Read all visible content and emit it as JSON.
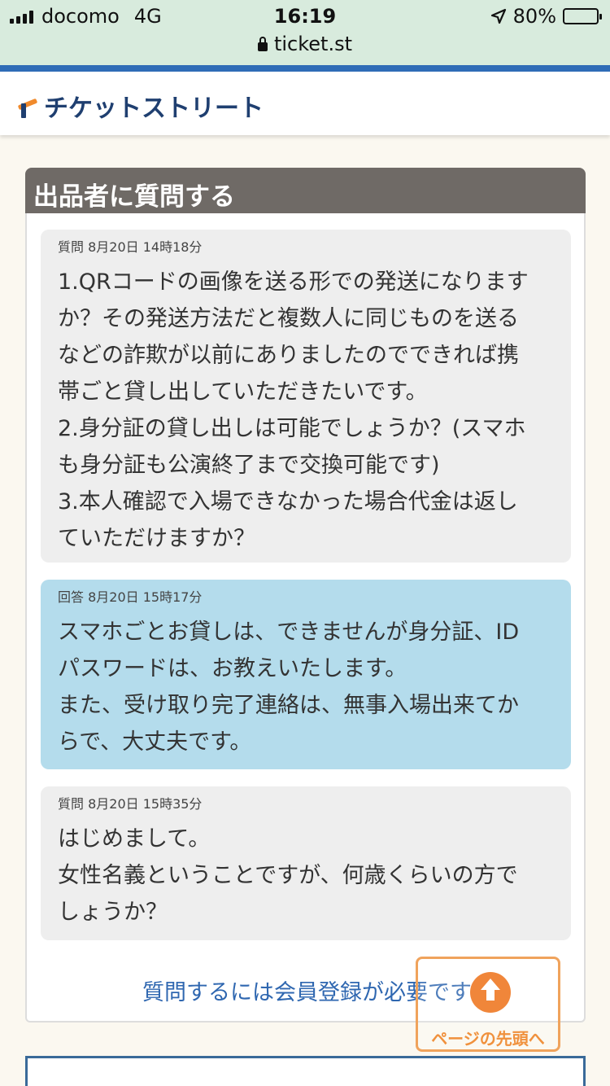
{
  "status_bar": {
    "carrier": "docomo",
    "network": "4G",
    "time": "16:19",
    "battery": "80%",
    "battery_level": 0.8,
    "url": "ticket.st"
  },
  "header": {
    "logo_text": "チケットストリート"
  },
  "section": {
    "title": "出品者に質問する"
  },
  "messages": [
    {
      "meta": "質問 8月20日 14時18分",
      "lines": [
        "1.QRコードの画像を送る形での発送になります",
        "か？その発送方法だと複数人に同じものを送る",
        "などの詐欺が以前にありましたのでできれば携",
        "帯ごと貸し出していただきたいです。",
        "2.身分証の貸し出しは可能でしょうか？(スマホ",
        "も身分証も公演終了まで交換可能です)",
        "3.本人確認で入場できなかった場合代金は返し",
        "ていただけますか？"
      ]
    },
    {
      "meta": "回答 8月20日 15時17分",
      "lines": [
        "スマホごとお貸しは、できませんが身分証、ID",
        "パスワードは、お教えいたします。",
        "また、受け取り完了連絡は、無事入場出来てか",
        "らで、大丈夫です。"
      ]
    },
    {
      "meta": "質問 8月20日 15時35分",
      "lines": [
        "はじめまして。",
        "女性名義ということですが、何歳くらいの方で",
        "しょうか？"
      ]
    }
  ],
  "notice": "質問するには会員登録が必要です",
  "page_top": {
    "label": "ページの先頭へ"
  },
  "colors": {
    "question_bg": "#eeeeee",
    "answer_bg": "#b4dcec",
    "section_title_bg": "#6f6a66",
    "link": "#2f67b0",
    "accent_orange": "#f0863a",
    "header_blue": "#2f6cb7"
  }
}
